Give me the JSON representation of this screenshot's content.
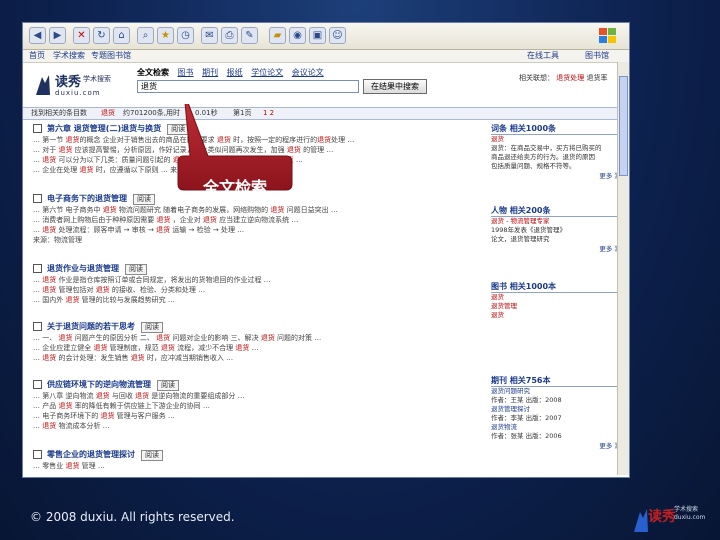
{
  "toolbar": {
    "buttons": [
      "back-icon",
      "forward-icon",
      "stop-icon",
      "refresh-icon",
      "home-icon",
      "search-icon",
      "favorites-icon",
      "history-icon",
      "mail-icon",
      "print-icon",
      "edit-icon",
      "discuss-icon",
      "folder-icon",
      "media-icon",
      "messenger-icon"
    ]
  },
  "linksbar": {
    "items": [
      "首页",
      "学术搜索",
      "专题图书馆",
      "在线工具",
      "图书馆"
    ]
  },
  "site": {
    "logo_main": "读秀",
    "logo_tag": "学术搜索",
    "logo_url": "duxiu.com",
    "tabs": [
      "全文检索",
      "图书",
      "期刊",
      "报纸",
      "学位论文",
      "会议论文"
    ],
    "search_value": "退货",
    "search_button": "在结果中搜索",
    "header_right_label": "相关联想：",
    "header_right_items": [
      "退货处理",
      "退货率"
    ]
  },
  "resultbar": {
    "label": "找到相关的条目数",
    "keyword": "退货",
    "count_text": "约701200条,用时",
    "time_text": "0.01秒",
    "page_text": "第1页",
    "pages": "1 2"
  },
  "results": [
    {
      "title": "第六章 退货管理(二)退货与换货",
      "tag": "阅读",
      "lines": [
        "… 第一节 退货的概念 企业对于销售出去的商品在顾客要求 退货 时，按照一定的程序进行的退货处理 …",
        "… 对于 退货 应该提高警惕，分析原因，作好记录，防止类似问题再次发生，加强 退货 的管理 …",
        "… 退货 可以分为以下几类：质量问题引起的 退货 ；错发货引起的 退货 ；过期 退货 …",
        "… 企业在处理 退货 时，应遵循以下原则 …   来源：电子商务物流管理"
      ]
    },
    {
      "title": "电子商务下的退货管理",
      "tag": "阅读",
      "lines": [
        "… 第六节 电子商务中 退货 物流问题研究 随着电子商务的发展，网络购物的 退货 问题日益突出 …",
        "… 消费者网上购物后由于种种原因需要 退货 ，企业对 退货 应当建立逆向物流系统 …",
        "… 退货 处理流程：顾客申请 → 审核 → 退货 运输 → 检验 → 处理 …",
        "来源：物流管理"
      ]
    },
    {
      "title": "退货作业与退货管理",
      "tag": "阅读",
      "lines": [
        "… 退货 作业是指仓库按照订单或合同规定，将发出的货物退回的作业过程 …",
        "… 退货 管理包括对 退货 的接收、检验、分类和处理 …",
        "… 国内外 退货 管理的比较与发展趋势研究 …"
      ]
    },
    {
      "title": "关于退货问题的若干思考",
      "tag": "阅读",
      "lines": [
        "… 一、 退货 问题产生的原因分析 二、 退货 问题对企业的影响 三、解决 退货 问题的对策 …",
        "… 企业应建立健全 退货 管理制度，规范 退货 流程，减少不合理 退货 …",
        "… 退货 的会计处理：发生销售 退货 时，应冲减当期销售收入 …"
      ]
    },
    {
      "title": "供应链环境下的逆向物流管理",
      "tag": "阅读",
      "lines": [
        "… 第八章 逆向物流 退货 与回收 退货 是逆向物流的重要组成部分 …",
        "… 产品 退货 率的降低有赖于供应链上下游企业的协同 …",
        "… 电子商务环境下的 退货 管理与客户服务 …",
        "… 退货 物流成本分析 …"
      ]
    },
    {
      "title": "零售企业的退货管理探讨",
      "tag": "阅读",
      "lines": [
        "… 零售业 退货 管理 …"
      ]
    }
  ],
  "right": {
    "sections": [
      {
        "title": "词条 相关1000条",
        "lines": [
          "退货",
          "退货：在商品交易中，买方将已购买的",
          "商品退还给卖方的行为。退货的原因",
          "包括质量问题、规格不符等。",
          "更多 》"
        ]
      },
      {
        "title": "人物 相关200条",
        "lines": [
          "退货 - 物流管理专家",
          "1998年发表《退货管理》",
          "论文，退货管理研究",
          "更多 》"
        ]
      },
      {
        "title": "图书 相关1000本",
        "lines": [
          "退货",
          "退货管理",
          "退货"
        ]
      },
      {
        "title": "期刊 相关756本",
        "lines": [
          "退货问题研究",
          "作者：王某 出版：2008",
          "退货管理探讨",
          "作者：李某 出版：2007",
          "退货物流",
          "作者：张某 出版：2006",
          "更多 》"
        ]
      }
    ]
  },
  "callout": {
    "label": "全文检索"
  },
  "footer": {
    "copyright": "© 2008 duxiu. All rights reserved."
  },
  "bottom_logo": {
    "main": "读秀",
    "sub1": "学术搜索",
    "sub2": "duxiu.com"
  }
}
